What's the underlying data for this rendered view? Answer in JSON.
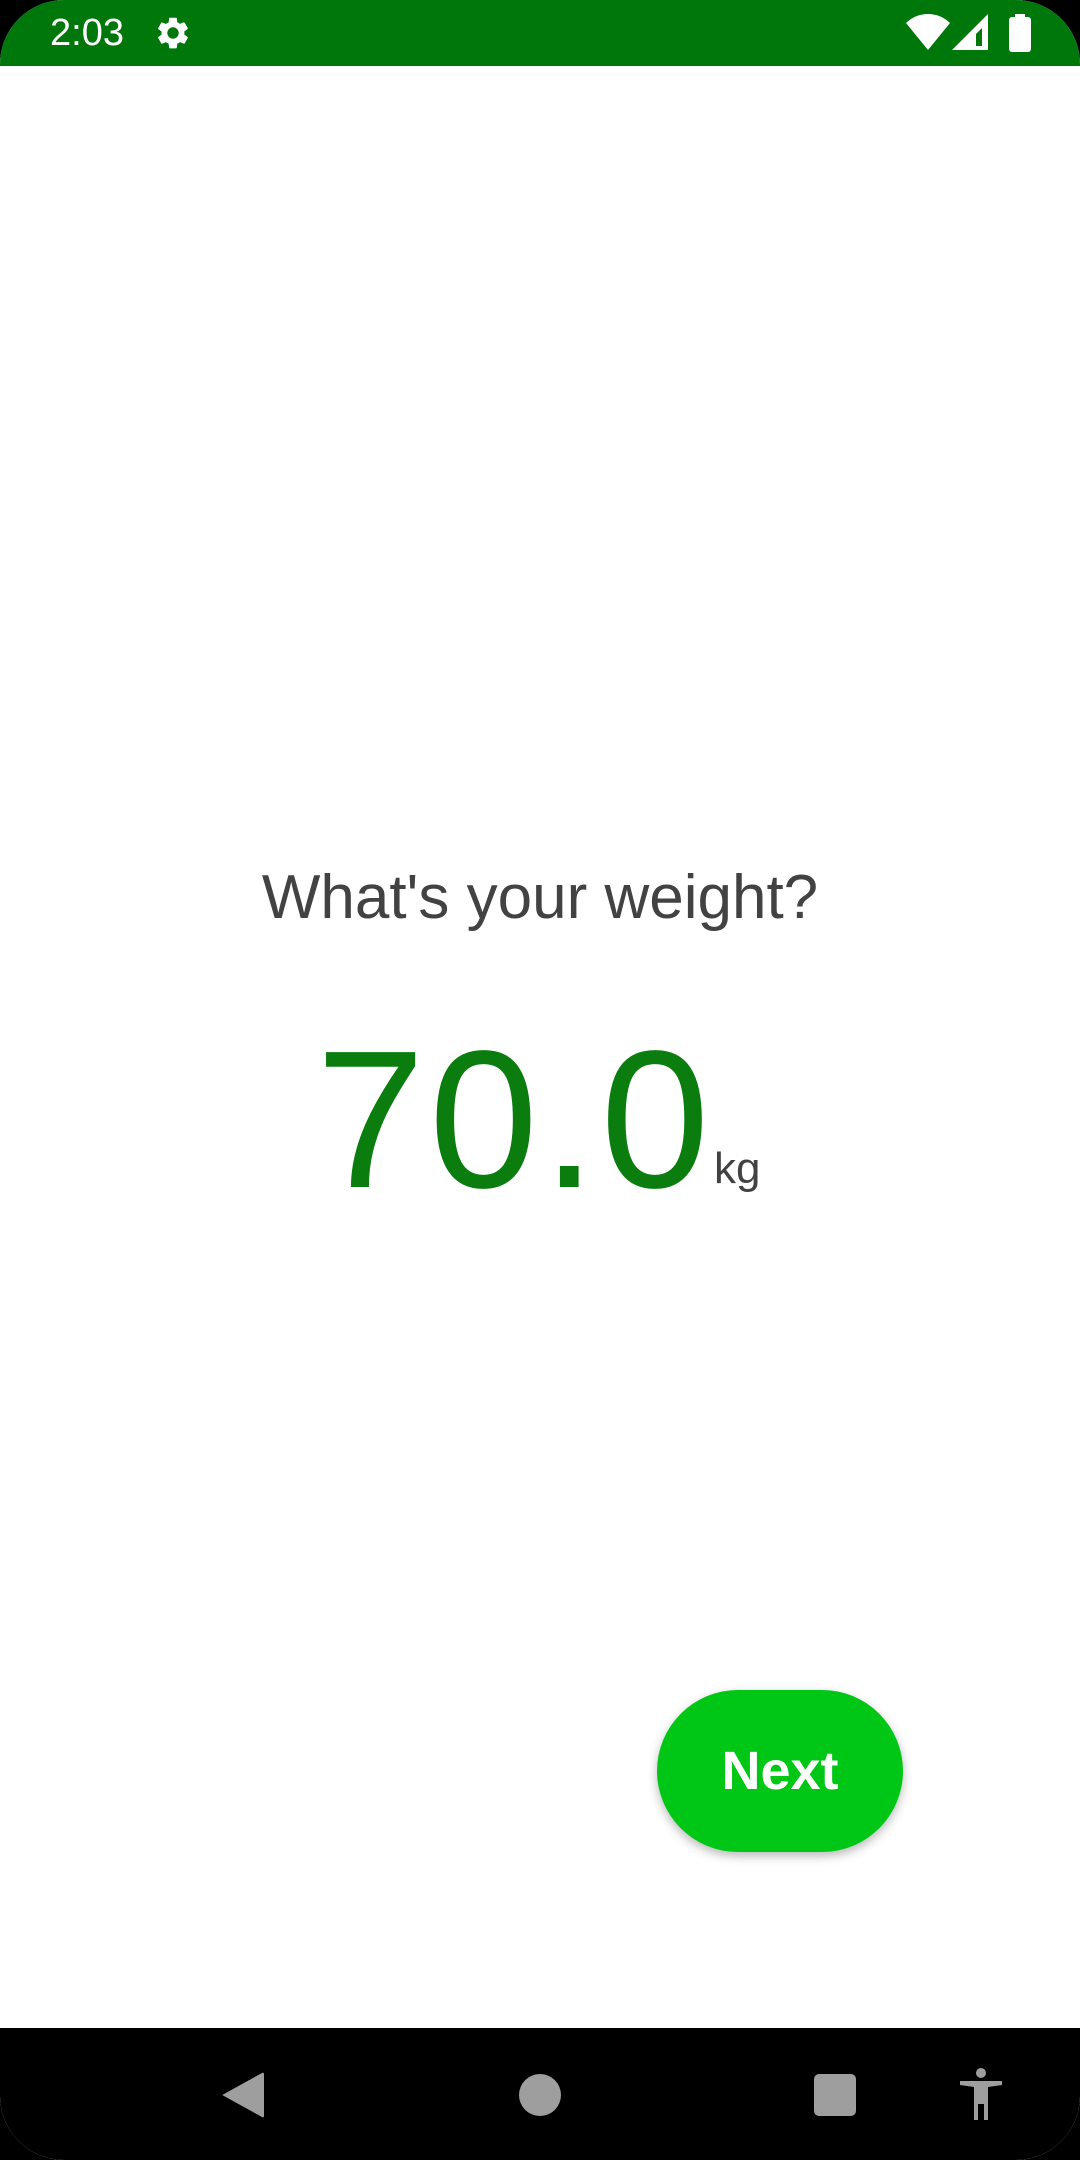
{
  "status_bar": {
    "time": "2:03",
    "background_color": "#00770b",
    "icons": [
      "gear-icon",
      "wifi-icon",
      "cell-signal-icon",
      "battery-icon"
    ]
  },
  "main": {
    "question": "What's your weight?",
    "weight_value": "70.0",
    "weight_unit": "kg",
    "value_color": "#0b7d0e"
  },
  "actions": {
    "next_label": "Next",
    "next_color": "#00c716"
  },
  "nav_bar": {
    "icons": [
      "back-icon",
      "home-icon",
      "recents-icon",
      "accessibility-icon"
    ]
  }
}
